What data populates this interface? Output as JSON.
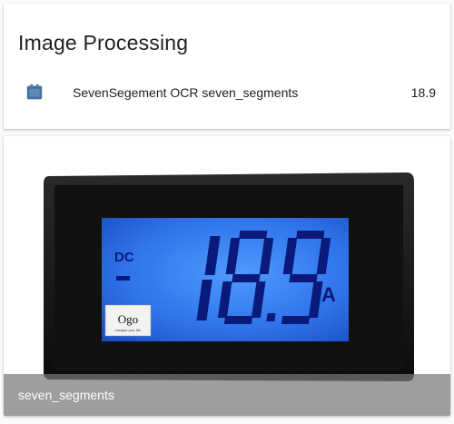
{
  "entities_card": {
    "title": "Image Processing",
    "rows": [
      {
        "icon": "image-filter-center-focus-icon",
        "name": "SevenSegement OCR seven_segments",
        "state": "18.9"
      }
    ]
  },
  "camera_card": {
    "name": "seven_segments",
    "display": {
      "mode": "DC",
      "sign": "-",
      "reading": "18.9",
      "unit": "A",
      "brand": "Ogo",
      "brand_tagline": "energize your life"
    }
  },
  "colors": {
    "accent_icon": "#44739e",
    "lcd_glow": "#3a8cff",
    "digit": "#0a1a7a"
  }
}
